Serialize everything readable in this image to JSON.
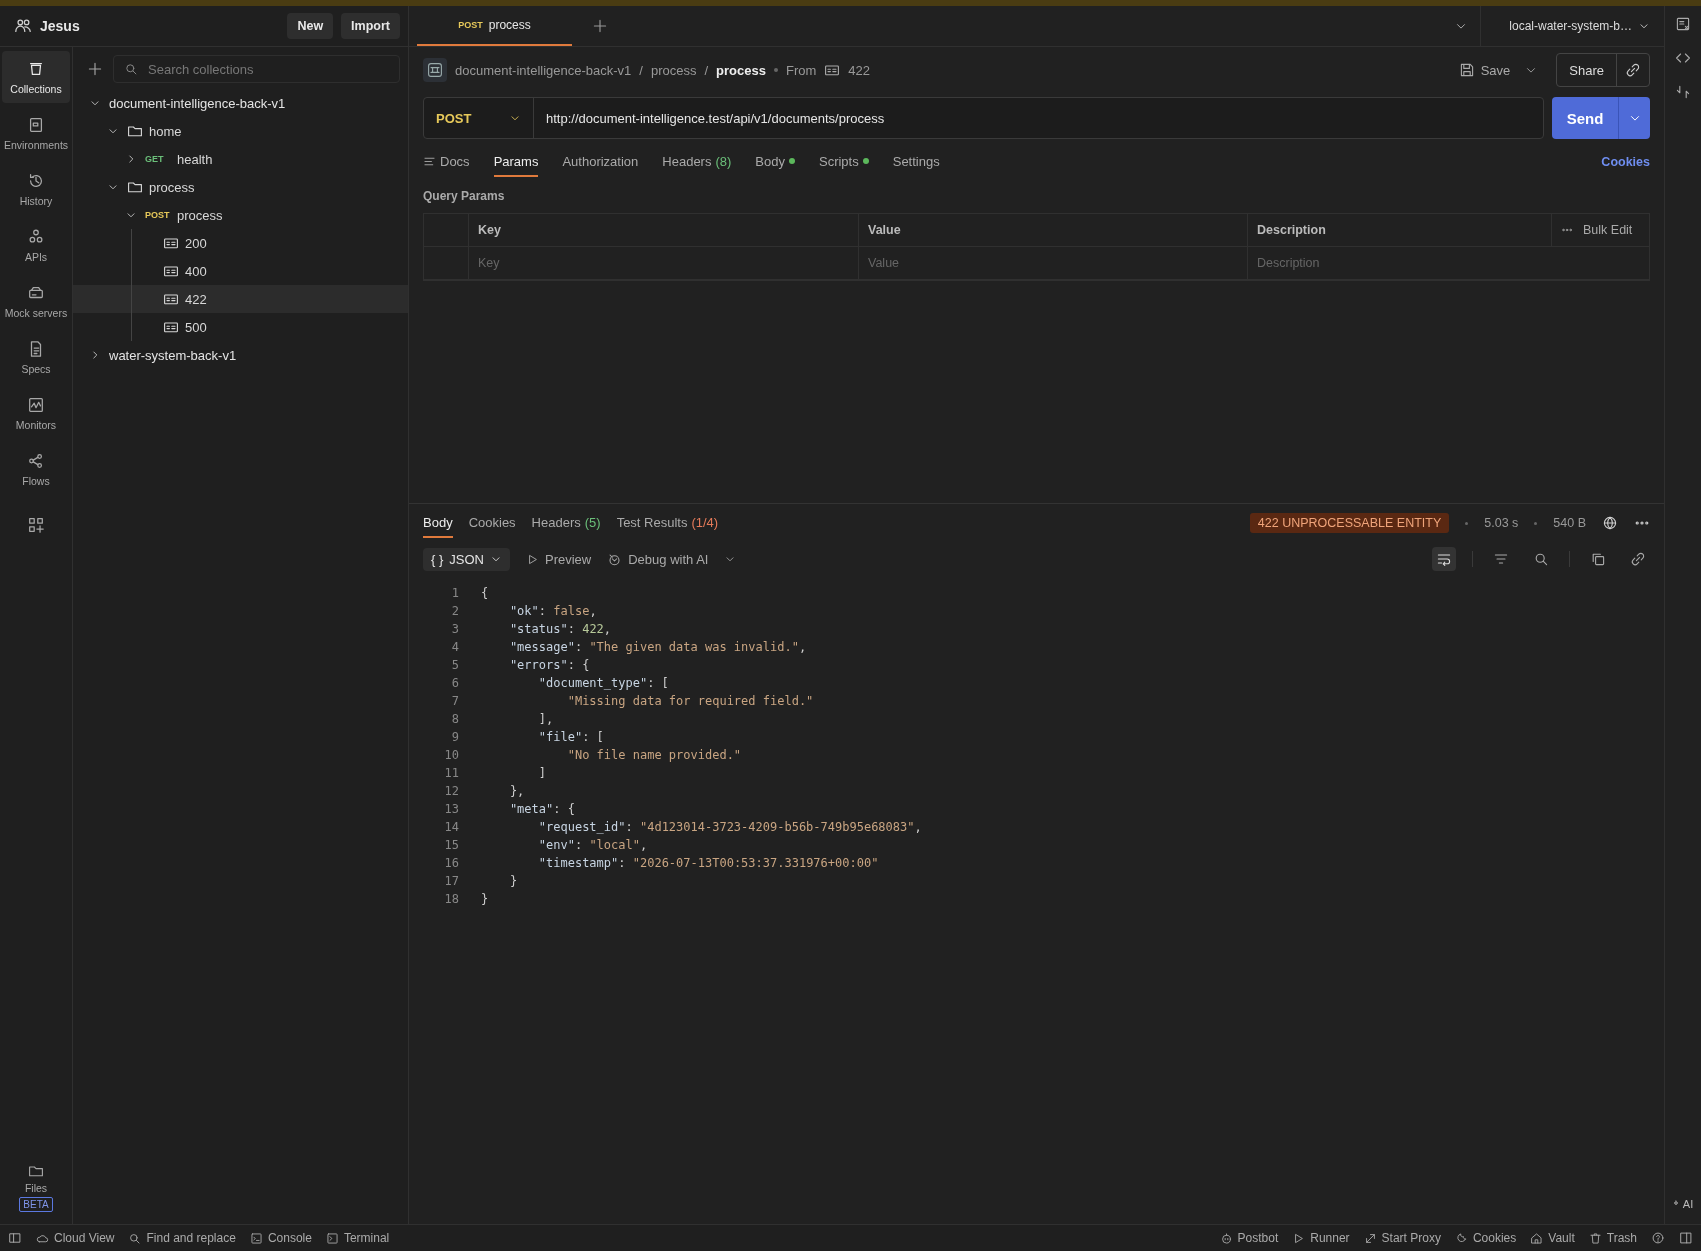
{
  "workspace": {
    "name": "Jesus",
    "buttons": [
      "New",
      "Import"
    ]
  },
  "rail": {
    "items": [
      {
        "label": "Collections",
        "selected": true
      },
      {
        "label": "Environments",
        "selected": false
      },
      {
        "label": "History",
        "selected": false
      },
      {
        "label": "APIs",
        "selected": false
      },
      {
        "label": "Mock servers",
        "selected": false
      },
      {
        "label": "Specs",
        "selected": false
      },
      {
        "label": "Monitors",
        "selected": false
      },
      {
        "label": "Flows",
        "selected": false
      }
    ],
    "files": {
      "label": "Files",
      "badge": "BETA"
    }
  },
  "collections": {
    "search": {
      "placeholder": "Search collections"
    },
    "tree": [
      {
        "kind": "collection",
        "label": "document-intelligence-back-v1",
        "expanded": true,
        "selected": false,
        "children": [
          {
            "kind": "folder",
            "label": "home",
            "expanded": true,
            "selected": false,
            "children": [
              {
                "kind": "request",
                "method": "GET",
                "label": "health",
                "expanded": false,
                "selected": false
              }
            ]
          },
          {
            "kind": "folder",
            "label": "process",
            "expanded": true,
            "selected": false,
            "children": [
              {
                "kind": "request",
                "method": "POST",
                "label": "process",
                "expanded": true,
                "selected": false,
                "children": [
                  {
                    "kind": "example",
                    "label": "200",
                    "selected": false
                  },
                  {
                    "kind": "example",
                    "label": "400",
                    "selected": false
                  },
                  {
                    "kind": "example",
                    "label": "422",
                    "selected": true
                  },
                  {
                    "kind": "example",
                    "label": "500",
                    "selected": false
                  }
                ]
              }
            ]
          }
        ]
      },
      {
        "kind": "collection",
        "label": "water-system-back-v1",
        "expanded": false,
        "selected": false
      }
    ]
  },
  "tabs": [
    {
      "method": "POST",
      "label": "process",
      "selected": true
    }
  ],
  "environment": {
    "label": "local-water-system-b…"
  },
  "breadcrumb": {
    "parts": [
      "document-intelligence-back-v1",
      "process",
      "process"
    ],
    "separators": [
      "/",
      "/"
    ],
    "from_label": "From",
    "from_example": "422"
  },
  "actions": {
    "save": "Save",
    "share": "Share"
  },
  "request": {
    "method": "POST",
    "url": "http://document-intelligence.test/api/v1/documents/process",
    "send": "Send"
  },
  "request_tabs": [
    {
      "label": "Docs",
      "selected": false
    },
    {
      "label": "Params",
      "selected": true
    },
    {
      "label": "Authorization",
      "selected": false
    },
    {
      "label": "Headers",
      "count": "(8)",
      "selected": false
    },
    {
      "label": "Body",
      "dot": true,
      "selected": false
    },
    {
      "label": "Scripts",
      "dot": true,
      "selected": false
    },
    {
      "label": "Settings",
      "selected": false
    }
  ],
  "cookies_link": "Cookies",
  "query_params": {
    "title": "Query Params",
    "columns": [
      "Key",
      "Value",
      "Description"
    ],
    "bulk_edit": "Bulk Edit",
    "placeholders": [
      "Key",
      "Value",
      "Description"
    ]
  },
  "response_tabs": [
    {
      "label": "Body",
      "selected": true
    },
    {
      "label": "Cookies",
      "selected": false
    },
    {
      "label": "Headers",
      "count": "(5)",
      "color": "#6bbf7a",
      "selected": false
    },
    {
      "label": "Test Results",
      "count": "(1/4)",
      "color": "#e57b5a",
      "selected": false
    }
  ],
  "response_meta": {
    "status": "422 UNPROCESSABLE ENTITY",
    "time": "5.03 s",
    "size": "540 B"
  },
  "response_toolbar": {
    "format_icon": "{ }",
    "format": "JSON",
    "preview": "Preview",
    "debug": "Debug with AI"
  },
  "code": [
    {
      "number": "1",
      "tokens": [
        {
          "kind": "punct",
          "text": "{"
        }
      ]
    },
    {
      "number": "2",
      "tokens": [
        {
          "kind": "key",
          "text": "    \"ok\""
        },
        {
          "kind": "punct",
          "text": ": "
        },
        {
          "kind": "bool",
          "text": "false"
        },
        {
          "kind": "punct",
          "text": ","
        }
      ]
    },
    {
      "number": "3",
      "tokens": [
        {
          "kind": "key",
          "text": "    \"status\""
        },
        {
          "kind": "punct",
          "text": ": "
        },
        {
          "kind": "number",
          "text": "422"
        },
        {
          "kind": "punct",
          "text": ","
        }
      ]
    },
    {
      "number": "4",
      "tokens": [
        {
          "kind": "key",
          "text": "    \"message\""
        },
        {
          "kind": "punct",
          "text": ": "
        },
        {
          "kind": "string",
          "text": "\"The given data was invalid.\""
        },
        {
          "kind": "punct",
          "text": ","
        }
      ]
    },
    {
      "number": "5",
      "tokens": [
        {
          "kind": "key",
          "text": "    \"errors\""
        },
        {
          "kind": "punct",
          "text": ": {"
        }
      ]
    },
    {
      "number": "6",
      "tokens": [
        {
          "kind": "key",
          "text": "        \"document_type\""
        },
        {
          "kind": "punct",
          "text": ": ["
        }
      ]
    },
    {
      "number": "7",
      "tokens": [
        {
          "kind": "string",
          "text": "            \"Missing data for required field.\""
        }
      ]
    },
    {
      "number": "8",
      "tokens": [
        {
          "kind": "punct",
          "text": "        ],"
        }
      ]
    },
    {
      "number": "9",
      "tokens": [
        {
          "kind": "key",
          "text": "        \"file\""
        },
        {
          "kind": "punct",
          "text": ": ["
        }
      ]
    },
    {
      "number": "10",
      "tokens": [
        {
          "kind": "string",
          "text": "            \"No file name provided.\""
        }
      ]
    },
    {
      "number": "11",
      "tokens": [
        {
          "kind": "punct",
          "text": "        ]"
        }
      ]
    },
    {
      "number": "12",
      "tokens": [
        {
          "kind": "punct",
          "text": "    },"
        }
      ]
    },
    {
      "number": "13",
      "tokens": [
        {
          "kind": "key",
          "text": "    \"meta\""
        },
        {
          "kind": "punct",
          "text": ": {"
        }
      ]
    },
    {
      "number": "14",
      "tokens": [
        {
          "kind": "key",
          "text": "        \"request_id\""
        },
        {
          "kind": "punct",
          "text": ": "
        },
        {
          "kind": "string",
          "text": "\"4d123014-3723-4209-b56b-749b95e68083\""
        },
        {
          "kind": "punct",
          "text": ","
        }
      ]
    },
    {
      "number": "15",
      "tokens": [
        {
          "kind": "key",
          "text": "        \"env\""
        },
        {
          "kind": "punct",
          "text": ": "
        },
        {
          "kind": "string",
          "text": "\"local\""
        },
        {
          "kind": "punct",
          "text": ","
        }
      ]
    },
    {
      "number": "16",
      "tokens": [
        {
          "kind": "key",
          "text": "        \"timestamp\""
        },
        {
          "kind": "punct",
          "text": ": "
        },
        {
          "kind": "string",
          "text": "\"2026-07-13T00:53:37.331976+00:00\""
        }
      ]
    },
    {
      "number": "17",
      "tokens": [
        {
          "kind": "punct",
          "text": "    }"
        }
      ]
    },
    {
      "number": "18",
      "tokens": [
        {
          "kind": "punct",
          "text": "}"
        }
      ]
    }
  ],
  "ai_button": {
    "label": "AI"
  },
  "status_bar": {
    "left": [
      "Cloud View",
      "Find and replace",
      "Console",
      "Terminal"
    ],
    "right": [
      "Postbot",
      "Runner",
      "Start Proxy",
      "Cookies",
      "Vault",
      "Trash"
    ]
  }
}
